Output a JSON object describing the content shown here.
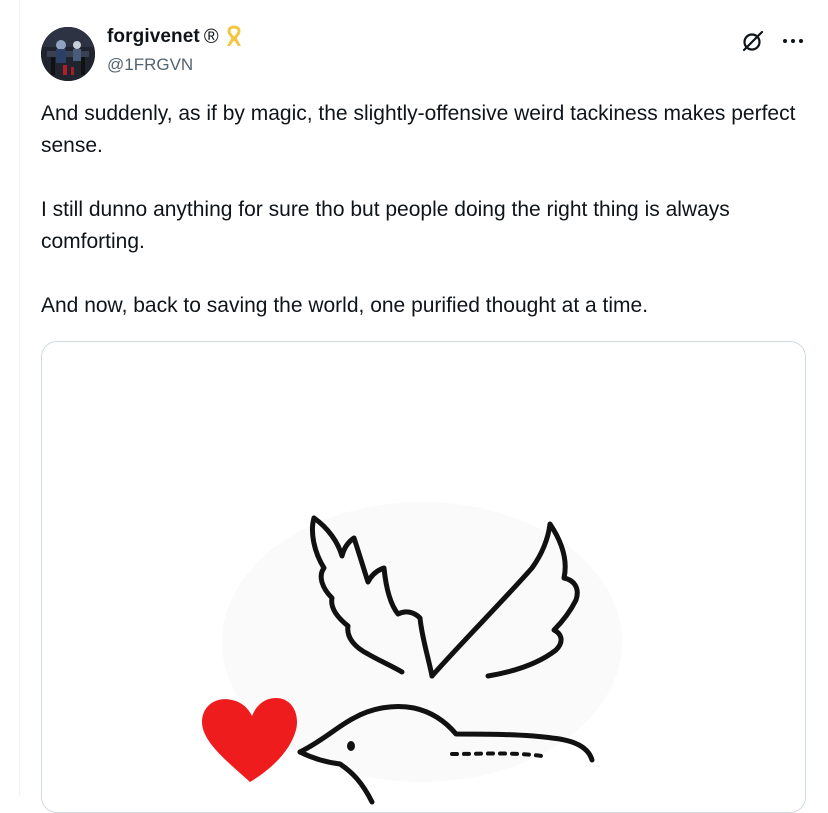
{
  "author": {
    "display_name": "forgivenet",
    "registered_mark": "®",
    "badge_icon": "ribbon-icon",
    "badge_color": "#f5c542",
    "handle": "@1FRGVN"
  },
  "actions": {
    "grok_icon": "grok-icon",
    "more_icon": "more-icon"
  },
  "tweet": {
    "paragraphs": [
      "And suddenly, as if by magic, the slightly-offensive weird tackiness makes perfect sense.",
      "I still dunno anything for sure tho but people doing the right thing is always comforting.",
      "And now, back to saving the world, one purified thought at a time."
    ]
  },
  "media": {
    "image_subject": "dove-with-heart-drawing",
    "heart_color": "#ee1c1c",
    "line_color": "#111111"
  }
}
